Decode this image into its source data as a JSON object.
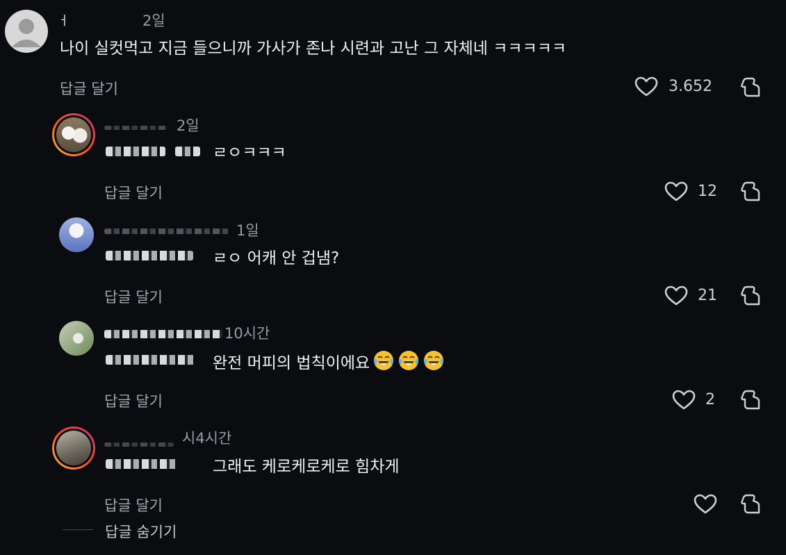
{
  "comments": [
    {
      "name": "ㅓ",
      "time": "2일",
      "text": "나이 실컷먹고 지금 들으니까 가사가 존나 시련과 고난 그 자체네 ㅋㅋㅋㅋㅋ",
      "reply_label": "답글 달기",
      "likes": "3.652"
    },
    {
      "time": "2일",
      "text": "ㄹㅇㅋㅋㅋ",
      "reply_label": "답글 달기",
      "likes": "12"
    },
    {
      "time": "1일",
      "text": "ㄹㅇ 어캐 안 겁냄?",
      "reply_label": "답글 달기",
      "likes": "21"
    },
    {
      "time": "10시간",
      "text": "완전 머피의 법칙이에요",
      "emoji": "joy-emoji",
      "reply_label": "답글 달기",
      "likes": "2"
    },
    {
      "time": "시4시간",
      "text": "그래도 케로케로케로 힘차게",
      "reply_label": "답글 달기",
      "likes": ""
    }
  ],
  "hide_replies_label": "답글 숨기기",
  "icons": {
    "like": "heart-outline-icon",
    "dislike": "thumbs-down-icon"
  },
  "colors": {
    "background": "#0b0c10",
    "story_ring_start": "#f7b733",
    "story_ring_end": "#c13584"
  }
}
